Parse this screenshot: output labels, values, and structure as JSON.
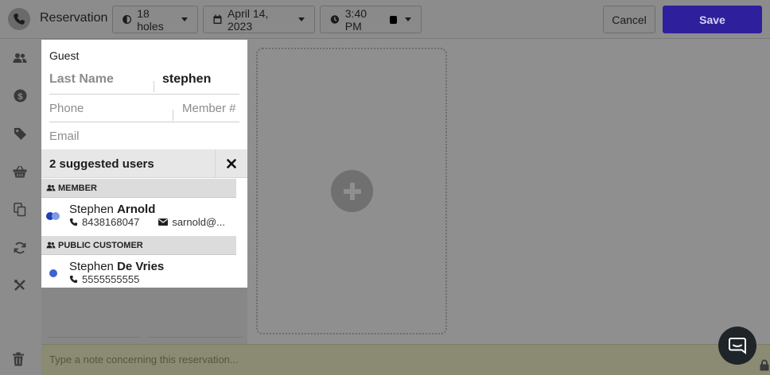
{
  "header": {
    "title": "Reservation",
    "holes": "18 holes",
    "date": "April 14, 2023",
    "time": "3:40 PM",
    "cancel_label": "Cancel",
    "save_label": "Save"
  },
  "guest_panel": {
    "label": "Guest",
    "last_name_placeholder": "Last Name",
    "first_name_value": "stephen",
    "phone_placeholder": "Phone",
    "member_placeholder": "Member #",
    "email_placeholder": "Email",
    "suggestions_text": "2 suggested users",
    "groups": [
      {
        "title": "MEMBER",
        "user": {
          "first": "Stephen",
          "last": "Arnold",
          "phone": "8438168047",
          "email": "sarnold@..."
        }
      },
      {
        "title": "PUBLIC CUSTOMER",
        "user": {
          "first": "Stephen",
          "last": "De Vries",
          "phone": "5555555555"
        }
      }
    ]
  },
  "note": {
    "placeholder": "Type a note concerning this reservation..."
  },
  "colors": {
    "save": "#2e1f9c",
    "member_dot_1": "#1f3fb4",
    "member_dot_2": "#7f9be5",
    "customer_dot": "#3c63d2"
  },
  "icons": [
    "phone-icon",
    "golf-icon",
    "calendar-icon",
    "clock-icon",
    "users-icon",
    "dollar-icon",
    "tag-icon",
    "basket-icon",
    "copy-icon",
    "sync-icon",
    "tools-icon",
    "trash-icon",
    "lock-icon",
    "chat-icon",
    "plus-icon",
    "close-icon"
  ]
}
